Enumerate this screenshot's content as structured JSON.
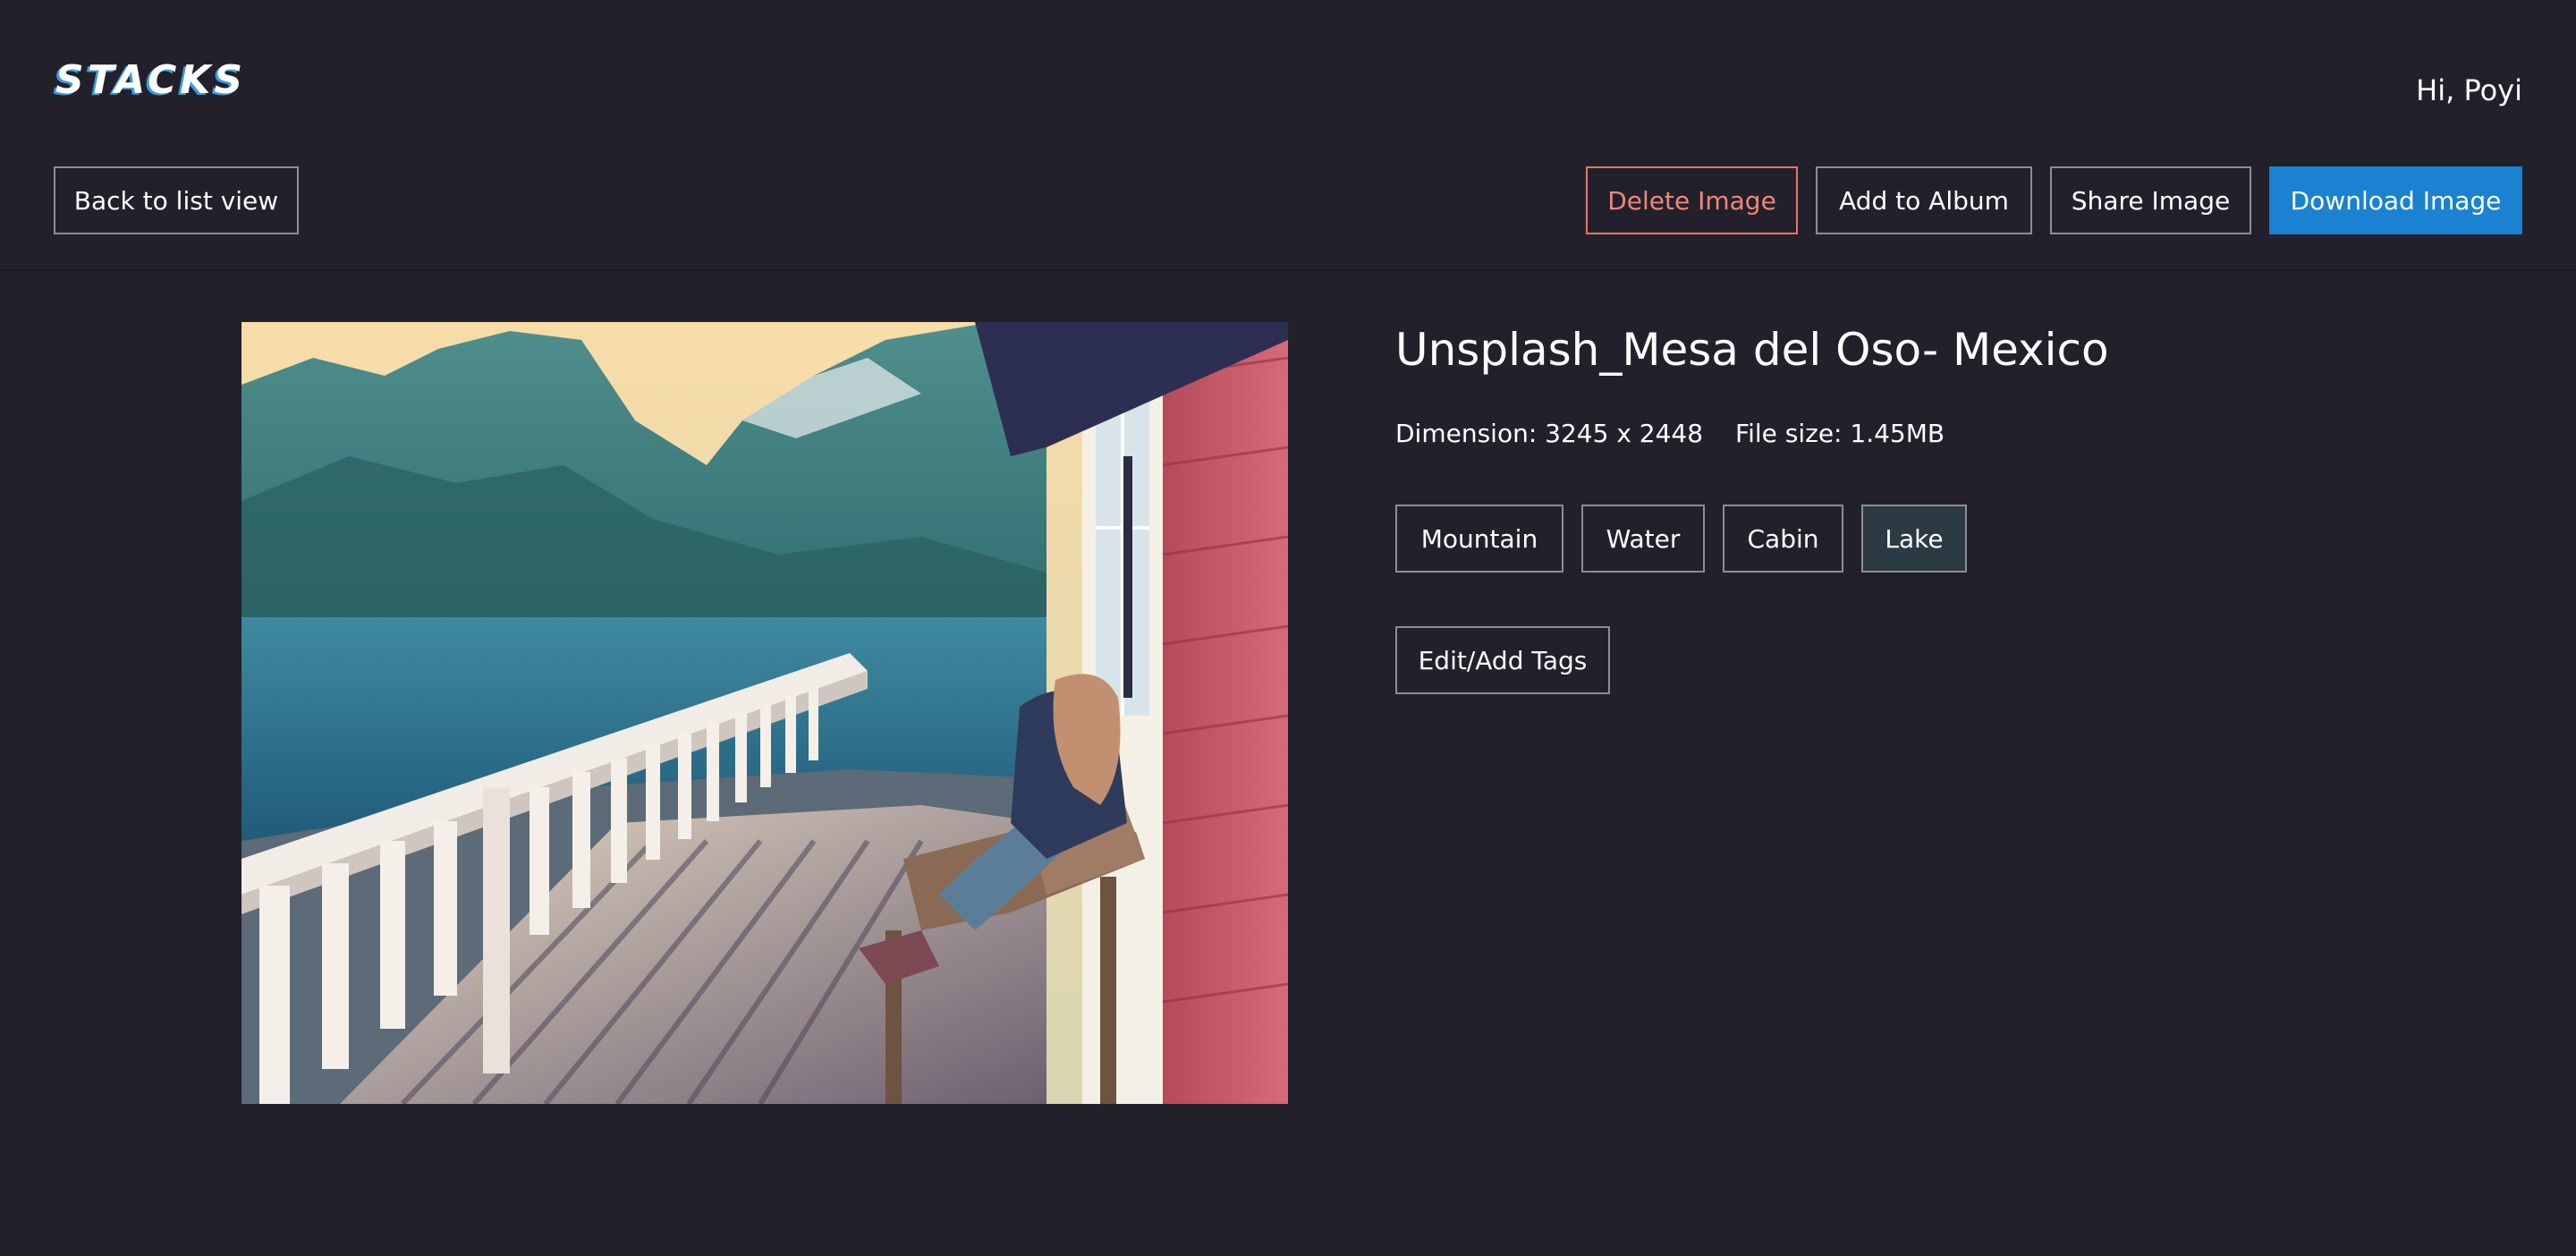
{
  "header": {
    "logo": "STACKS",
    "greeting": "Hi, Poyi"
  },
  "toolbar": {
    "back_label": "Back to list view",
    "delete_label": "Delete Image",
    "album_label": "Add to Album",
    "share_label": "Share Image",
    "download_label": "Download Image"
  },
  "image": {
    "title": "Unsplash_Mesa del Oso- Mexico",
    "dimension": "Dimension: 3245 x 2448",
    "file_size": "File size: 1.45MB",
    "tags": [
      "Mountain",
      "Water",
      "Cabin",
      "Lake"
    ],
    "selected_tag": "Lake",
    "edit_tags_label": "Edit/Add Tags"
  },
  "colors": {
    "background": "#22212b",
    "primary": "#1a82d0",
    "danger": "#e8736c",
    "selected_tag": "#2c3a44"
  }
}
